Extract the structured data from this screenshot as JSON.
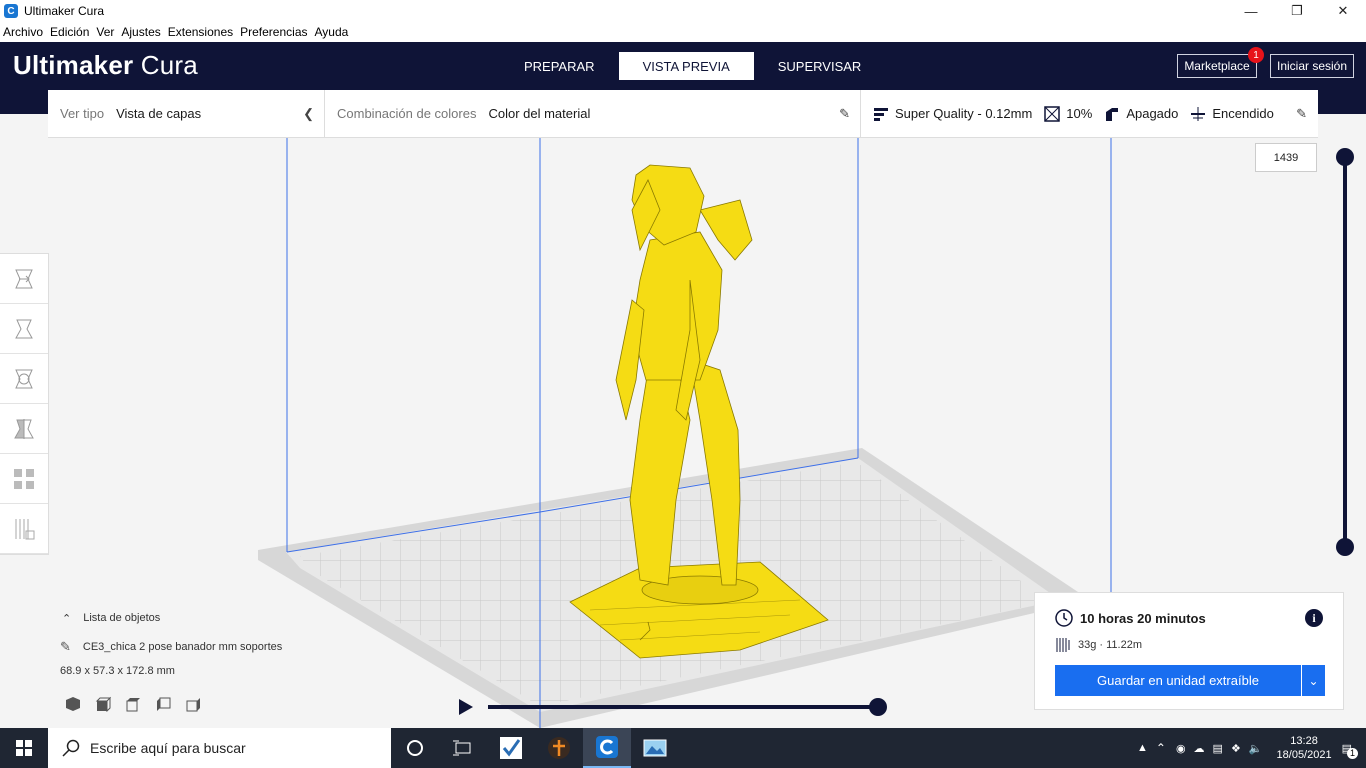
{
  "window": {
    "title": "Ultimaker Cura"
  },
  "menu": [
    "Archivo",
    "Edición",
    "Ver",
    "Ajustes",
    "Extensiones",
    "Preferencias",
    "Ayuda"
  ],
  "header": {
    "logo_bold": "Ultimaker",
    "logo_light": "Cura",
    "stages": [
      "PREPARAR",
      "VISTA PREVIA",
      "SUPERVISAR"
    ],
    "active_stage": "VISTA PREVIA",
    "marketplace_label": "Marketplace",
    "marketplace_badge": "1",
    "signin_label": "Iniciar sesión"
  },
  "toolbar": {
    "view_type_label": "Ver tipo",
    "view_type_value": "Vista de capas",
    "color_scheme_label": "Combinación de colores",
    "color_scheme_value": "Color del material",
    "profile": "Super Quality - 0.12mm",
    "infill": "10%",
    "support": "Apagado",
    "adhesion": "Encendido"
  },
  "layer_slider": {
    "current_layer": "1439"
  },
  "object_list": {
    "header": "Lista de objetos",
    "object_name": "CE3_chica 2 pose banador mm soportes",
    "dimensions": "68.9 x 57.3 x 172.8 mm"
  },
  "print_info": {
    "time": "10 horas 20 minutos",
    "material": "33g · 11.22m",
    "save_button": "Guardar en unidad extraíble"
  },
  "taskbar": {
    "search_placeholder": "Escribe aquí para buscar",
    "time": "13:28",
    "date": "18/05/2021",
    "notification_count": "1"
  },
  "colors": {
    "header_bg": "#0f1437",
    "accent_blue": "#196ef0",
    "model_yellow": "#f5dc14",
    "build_volume_line": "#3d6fe8"
  }
}
